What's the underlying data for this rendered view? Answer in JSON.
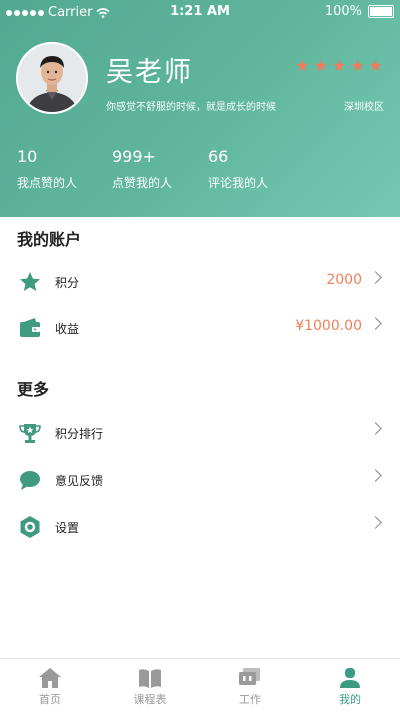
{
  "status_bar": {
    "carrier": "Carrier",
    "time": "1:21 AM",
    "battery": "100%"
  },
  "profile": {
    "name": "吴老师",
    "motto": "你感觉不舒服的时候，就是成长的时候",
    "campus": "深圳校区",
    "rating": 5,
    "stats": [
      {
        "value": "10",
        "label": "我点赞的人"
      },
      {
        "value": "999+",
        "label": "点赞我的人"
      },
      {
        "value": "66",
        "label": "评论我的人"
      }
    ]
  },
  "account": {
    "title": "我的账户",
    "items": [
      {
        "label": "积分",
        "value": "2000",
        "icon": "star-icon"
      },
      {
        "label": "收益",
        "value": "¥1000.00",
        "icon": "wallet-icon"
      }
    ]
  },
  "more": {
    "title": "更多",
    "items": [
      {
        "label": "积分排行",
        "icon": "trophy-icon"
      },
      {
        "label": "意见反馈",
        "icon": "chat-bubble-icon"
      },
      {
        "label": "设置",
        "icon": "settings-icon"
      }
    ]
  },
  "tabs": [
    {
      "label": "首页",
      "icon": "home-icon",
      "active": false
    },
    {
      "label": "课程表",
      "icon": "book-icon",
      "active": false
    },
    {
      "label": "工作",
      "icon": "work-icon",
      "active": false
    },
    {
      "label": "我的",
      "icon": "user-icon",
      "active": true
    }
  ],
  "colors": {
    "accent": "#5fb59c",
    "value": "#ef7f57",
    "star": "#f17b5a"
  }
}
